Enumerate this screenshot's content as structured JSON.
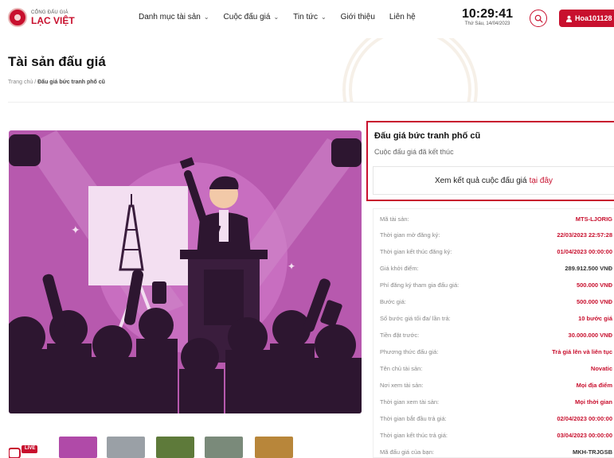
{
  "header": {
    "logo_small": "CỔNG ĐẤU GIÁ",
    "logo_big": "LẠC VIỆT",
    "nav": [
      {
        "label": "Danh mục tài sản",
        "has_dropdown": true
      },
      {
        "label": "Cuộc đấu giá",
        "has_dropdown": true
      },
      {
        "label": "Tin tức",
        "has_dropdown": true
      },
      {
        "label": "Giới thiệu",
        "has_dropdown": false
      },
      {
        "label": "Liên hệ",
        "has_dropdown": false
      }
    ],
    "clock_time": "10:29:41",
    "clock_date": "Thứ Sáu, 14/04/2023",
    "user_label": "Hoa101128",
    "search_icon": "search-icon",
    "user_icon": "user-icon"
  },
  "banner": {
    "title": "Tài sản đấu giá",
    "breadcrumb_home": "Trang chủ",
    "breadcrumb_sep": "/",
    "breadcrumb_current": "Đấu giá bức tranh phố cũ"
  },
  "gallery": {
    "live_label": "LIVE",
    "thumbnail_colors": [
      "#b04aa8",
      "#9aa0a6",
      "#5e7a3a",
      "#7a8a7a",
      "#b8863a"
    ]
  },
  "panel": {
    "asset_title": "Đấu giá bức tranh phố cũ",
    "status": "Cuộc đấu giá đã kết thúc",
    "view_result_text": "Xem kết quả cuộc đấu giá",
    "view_result_link": "tại đây",
    "rows": [
      {
        "label": "Mã tài sản:",
        "value": "MTS-LJORIG"
      },
      {
        "label": "Thời gian mở đăng ký:",
        "value": "22/03/2023 22:57:28"
      },
      {
        "label": "Thời gian kết thúc đăng ký:",
        "value": "01/04/2023 00:00:00"
      },
      {
        "label": "Giá khởi điểm:",
        "value": "289.912.500 VNĐ"
      },
      {
        "label": "Phí đăng ký tham gia đấu giá:",
        "value": "500.000 VNĐ"
      },
      {
        "label": "Bước giá:",
        "value": "500.000 VNĐ"
      },
      {
        "label": "Số bước giá tối đa/ lần trả:",
        "value": "10 bước giá"
      },
      {
        "label": "Tiền đặt trước:",
        "value": "30.000.000 VNĐ"
      },
      {
        "label": "Phương thức đấu giá:",
        "value": "Trả giá lên và liên tục"
      },
      {
        "label": "Tên chủ tài sản:",
        "value": "Novatic"
      },
      {
        "label": "Nơi xem tài sản:",
        "value": "Mọi địa điểm"
      },
      {
        "label": "Thời gian xem tài sản:",
        "value": "Mọi thời gian"
      },
      {
        "label": "Thời gian bắt đầu trả giá:",
        "value": "02/04/2023 00:00:00"
      },
      {
        "label": "Thời gian kết thúc trả giá:",
        "value": "03/04/2023 00:00:00"
      },
      {
        "label": "Mã đấu giá của bạn:",
        "value": "MKH-TRJGSB"
      }
    ]
  },
  "colors": {
    "brand_red": "#c8102e",
    "illustration_purple": "#c063b8",
    "illustration_dark": "#3a1d3d"
  }
}
